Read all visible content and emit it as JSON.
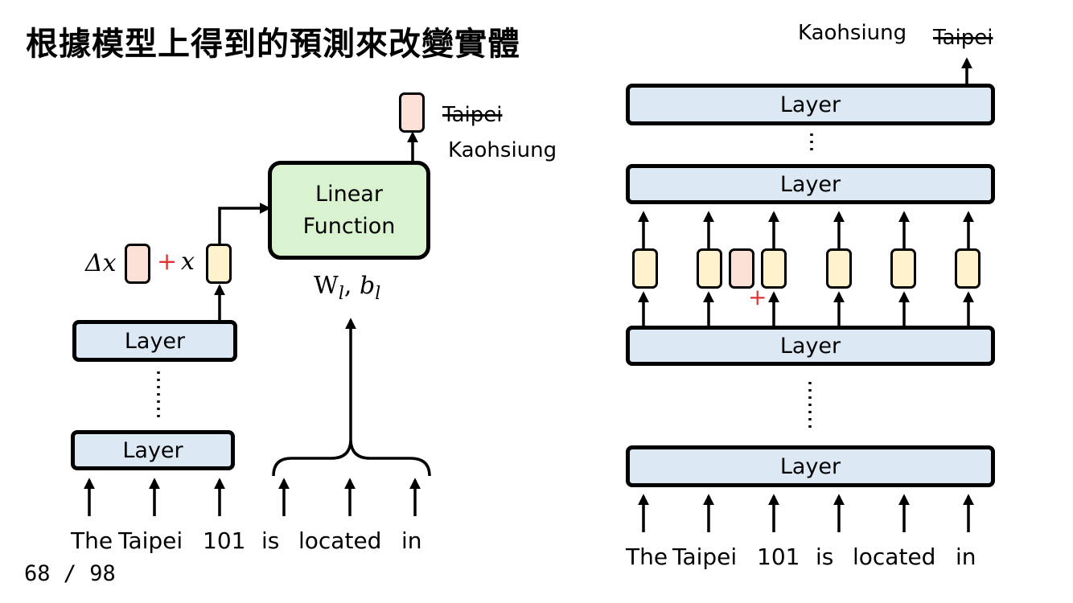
{
  "title": "根據模型上得到的預測來改變實體",
  "page_number": "68 / 98",
  "layer_label": "Layer",
  "linear": {
    "line1": "Linear",
    "line2": "Function",
    "params": "W",
    "l": "l",
    "b": "b"
  },
  "left": {
    "delta_x": "Δx",
    "plus": "+",
    "x": "x",
    "old_output": "Taipei",
    "new_output": "Kaohsiung",
    "tokens": [
      "The",
      "Taipei",
      "101",
      "is",
      "located",
      "in"
    ]
  },
  "right": {
    "plus": "+",
    "new_output": "Kaohsiung",
    "old_output": "Taipei",
    "tokens": [
      "The",
      "Taipei",
      "101",
      "is",
      "located",
      "in"
    ]
  },
  "colors": {
    "layer": "#dce9f5",
    "linear": "#d9f2d0",
    "hidden": "#fff2cc",
    "delta": "#fbe0d6",
    "plus": "#e03030"
  }
}
